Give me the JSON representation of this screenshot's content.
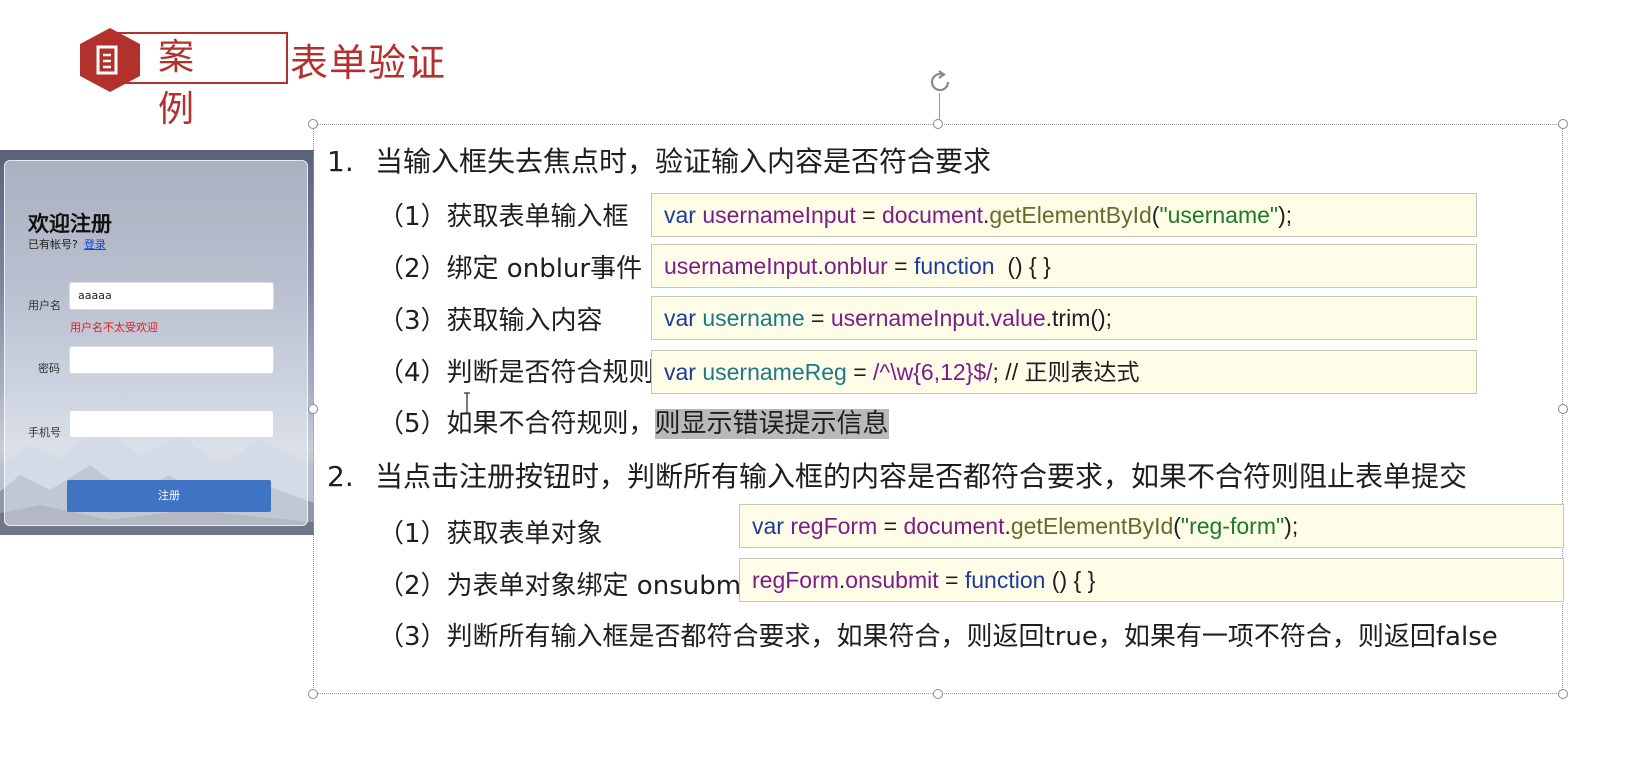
{
  "header": {
    "badge_label": "案例",
    "title": "表单验证",
    "badge_icon": "document-icon",
    "accent_color": "#b3312c"
  },
  "register_form": {
    "title": "欢迎注册",
    "has_account_text": "已有帐号?",
    "login_link": "登录",
    "username_label": "用户名",
    "username_value": "aaaaa",
    "username_error": "用户名不太受欢迎",
    "password_label": "密码",
    "password_value": "",
    "phone_label": "手机号",
    "phone_value": "",
    "submit_label": "注册",
    "button_color": "#3f73c4",
    "error_color": "#e02020"
  },
  "content": {
    "item1": {
      "num": "1.",
      "text": "当输入框失去焦点时，验证输入内容是否符合要求",
      "steps": [
        {
          "label": "（1）获取表单输入框"
        },
        {
          "label": "（2）绑定 onblur事件"
        },
        {
          "label": "（3）获取输入内容"
        },
        {
          "label": "（4）判断是否符合规则"
        },
        {
          "label_plain": "（5）如果不合符规则，",
          "label_highlight": "则显示错误提示信息"
        }
      ],
      "code": [
        {
          "c1": "var",
          "c2": "usernameInput",
          "c3": " = ",
          "c4": "document",
          "c5": ".",
          "c6": "getElementById",
          "c7": "(",
          "c8": "\"username\"",
          "c9": ");"
        },
        {
          "c1": "usernameInput",
          "c2": ".",
          "c3": "onblur",
          "c4": " = ",
          "c5": "function",
          "c6": "  () { }"
        },
        {
          "c1": "var",
          "c2": "username",
          "c3": " = ",
          "c4": "usernameInput",
          "c5": ".",
          "c6": "value",
          "c7": ".trim();"
        },
        {
          "c1": "var",
          "c2": "usernameReg",
          "c3": " = ",
          "c4": "/^\\w{6,12}$/",
          "c5": "; // 正则表达式"
        }
      ]
    },
    "item2": {
      "num": "2.",
      "text": "当点击注册按钮时，判断所有输入框的内容是否都符合要求，如果不合符则阻止表单提交",
      "steps": [
        {
          "label": "（1）获取表单对象"
        },
        {
          "label": "（2）为表单对象绑定 onsubmit"
        },
        {
          "label": "（3）判断所有输入框是否都符合要求，如果符合，则返回true，如果有一项不符合，则返回false"
        }
      ],
      "code": [
        {
          "c1": "var",
          "c2": "regForm",
          "c3": " = ",
          "c4": "document",
          "c5": ".",
          "c6": "getElementById",
          "c7": "(",
          "c8": "\"reg-form\"",
          "c9": ");"
        },
        {
          "c1": "regForm",
          "c2": ".",
          "c3": "onsubmit",
          "c4": " = ",
          "c5": "function",
          "c6": " () { }"
        }
      ]
    }
  },
  "code_colors": {
    "keyword": "#1b3c9c",
    "variable": "#7a1d8a",
    "method": "#666a2c",
    "string": "#1b7a28",
    "code_background": "#fffde8"
  }
}
